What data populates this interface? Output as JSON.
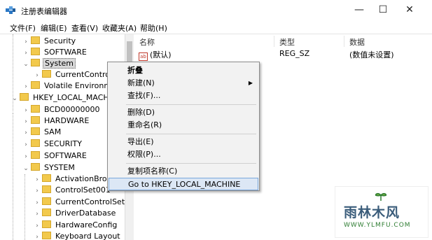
{
  "window": {
    "title": "注册表编辑器"
  },
  "menu": [
    {
      "label": "文件(F)"
    },
    {
      "label": "编辑(E)"
    },
    {
      "label": "查看(V)"
    },
    {
      "label": "收藏夹(A)"
    },
    {
      "label": "帮助(H)"
    }
  ],
  "tree": [
    {
      "label": "Security"
    },
    {
      "label": "SOFTWARE"
    },
    {
      "label": "System"
    },
    {
      "label": "CurrentControlS"
    },
    {
      "label": "Volatile Environme"
    },
    {
      "label": "HKEY_LOCAL_MACHIN"
    },
    {
      "label": "BCD00000000"
    },
    {
      "label": "HARDWARE"
    },
    {
      "label": "SAM"
    },
    {
      "label": "SECURITY"
    },
    {
      "label": "SOFTWARE"
    },
    {
      "label": "SYSTEM"
    },
    {
      "label": "ActivationBroke"
    },
    {
      "label": "ControlSet001"
    },
    {
      "label": "CurrentControlSet"
    },
    {
      "label": "DriverDatabase"
    },
    {
      "label": "HardwareConfig"
    },
    {
      "label": "Keyboard Layout"
    }
  ],
  "list": {
    "columns": {
      "name": "名称",
      "type": "类型",
      "data": "数据"
    },
    "rows": [
      {
        "icon": "ab",
        "name": "(默认)",
        "type": "REG_SZ",
        "data": "(数值未设置)"
      }
    ]
  },
  "context_menu": {
    "items": [
      {
        "label": "折叠"
      },
      {
        "label": "新建(N)"
      },
      {
        "label": "查找(F)..."
      },
      {
        "label": "删除(D)"
      },
      {
        "label": "重命名(R)"
      },
      {
        "label": "导出(E)"
      },
      {
        "label": "权限(P)..."
      },
      {
        "label": "复制项名称(C)"
      },
      {
        "label": "Go to HKEY_LOCAL_MACHINE"
      }
    ]
  },
  "watermark": {
    "title": "雨林木风",
    "url": "WWW.YLMFU.COM"
  },
  "colors": {
    "folder": "#f2c94c",
    "menu_highlight": "#dce7f5",
    "menu_bg": "#f2f2f2",
    "watermark_text": "#3a5c7a",
    "watermark_url": "#2e7d32"
  }
}
